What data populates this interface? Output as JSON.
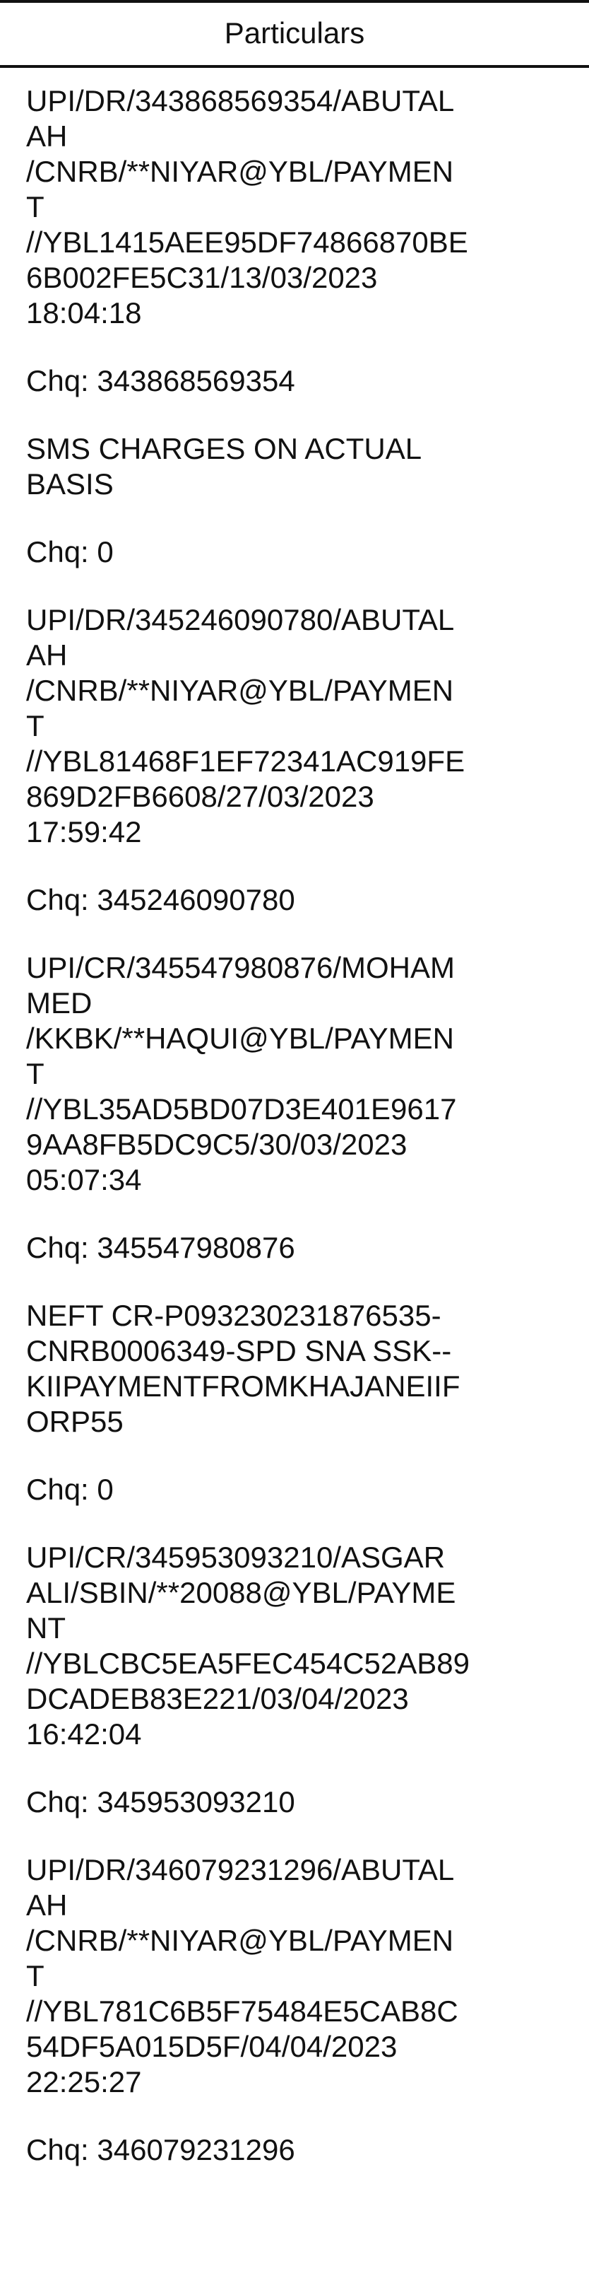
{
  "header": {
    "title": "Particulars"
  },
  "entries": [
    {
      "lines": [
        "UPI/DR/343868569354/ABUTAL",
        "AH",
        "/CNRB/**NIYAR@YBL/PAYMEN",
        "T",
        "//YBL1415AEE95DF74866870BE",
        "6B002FE5C31/13/03/2023",
        "18:04:18"
      ],
      "chq": "Chq: 343868569354"
    },
    {
      "lines": [
        "SMS CHARGES ON ACTUAL",
        "BASIS"
      ],
      "chq": "Chq: 0"
    },
    {
      "lines": [
        "UPI/DR/345246090780/ABUTAL",
        "AH",
        "/CNRB/**NIYAR@YBL/PAYMEN",
        "T",
        "//YBL81468F1EF72341AC919FE",
        "869D2FB6608/27/03/2023",
        "17:59:42"
      ],
      "chq": "Chq: 345246090780"
    },
    {
      "lines": [
        "UPI/CR/345547980876/MOHAM",
        "MED",
        "/KKBK/**HAQUI@YBL/PAYMEN",
        "T",
        "//YBL35AD5BD07D3E401E9617",
        "9AA8FB5DC9C5/30/03/2023",
        "05:07:34"
      ],
      "chq": "Chq: 345547980876"
    },
    {
      "lines": [
        "NEFT CR-P093230231876535-",
        "CNRB0006349-SPD SNA SSK--",
        "KIIPAYMENTFROMKHAJANEIIF",
        "ORP55"
      ],
      "chq": "Chq: 0"
    },
    {
      "lines": [
        "UPI/CR/345953093210/ASGAR",
        "ALI/SBIN/**20088@YBL/PAYME",
        "NT",
        "//YBLCBC5EA5FEC454C52AB89",
        "DCADEB83E221/03/04/2023",
        "16:42:04"
      ],
      "chq": "Chq: 345953093210"
    },
    {
      "lines": [
        "UPI/DR/346079231296/ABUTAL",
        "AH",
        "/CNRB/**NIYAR@YBL/PAYMEN",
        "T",
        "//YBL781C6B5F75484E5CAB8C",
        "54DF5A015D5F/04/04/2023",
        "22:25:27"
      ],
      "chq": "Chq: 346079231296"
    }
  ]
}
